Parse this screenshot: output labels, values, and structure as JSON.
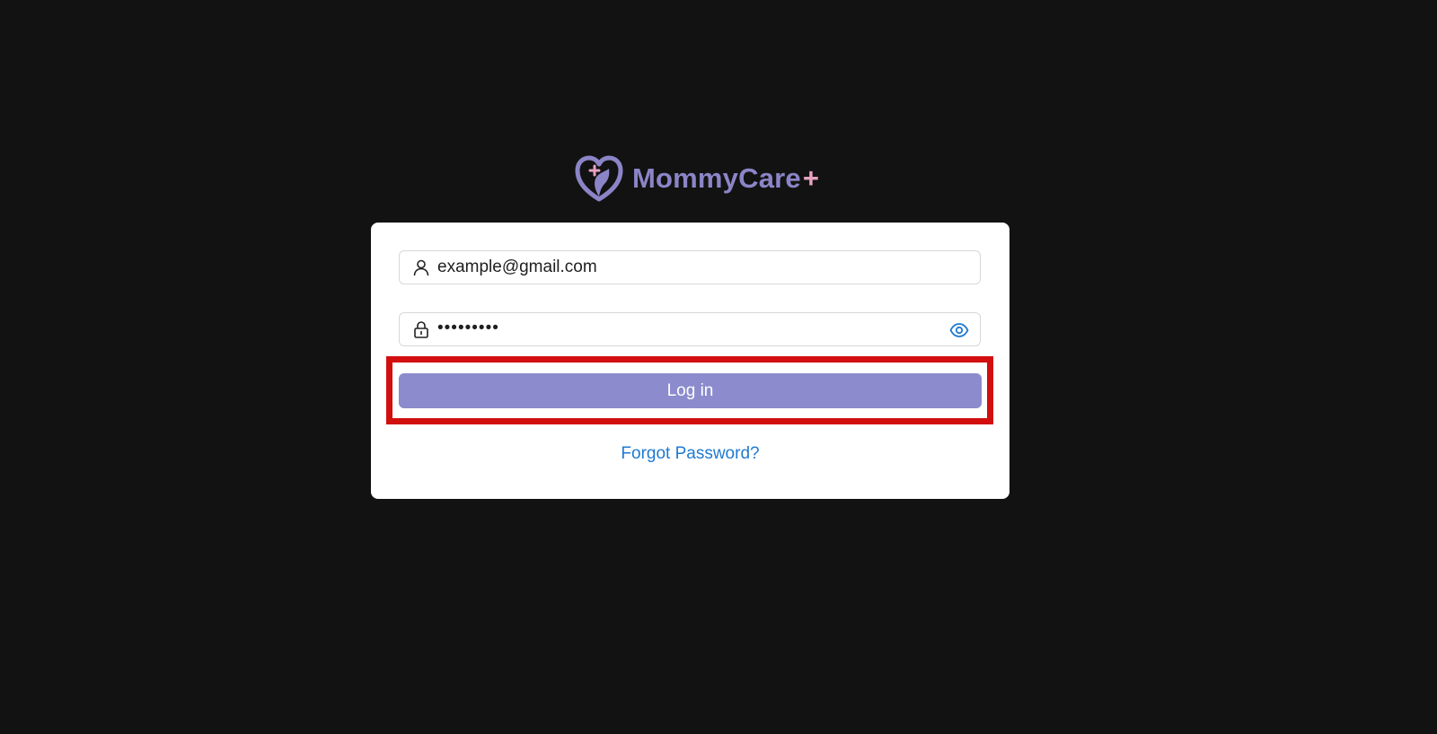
{
  "brand": {
    "name": "MommyCare",
    "plus": "+",
    "logo_icon": "heart-hand-logo-icon",
    "colors": {
      "primary": "#8b85c7",
      "accent": "#e7a2c1"
    }
  },
  "form": {
    "email": {
      "icon": "user-icon",
      "value": "example@gmail.com"
    },
    "password": {
      "icon": "lock-icon",
      "masked_value": "•••••••••",
      "toggle_icon": "eye-icon"
    },
    "login_label": "Log in",
    "forgot_label": "Forgot Password?"
  },
  "colors": {
    "background": "#121212",
    "card": "#ffffff",
    "button": "#8b8bce",
    "link": "#1e7ad1",
    "highlight": "#d20f0f"
  }
}
